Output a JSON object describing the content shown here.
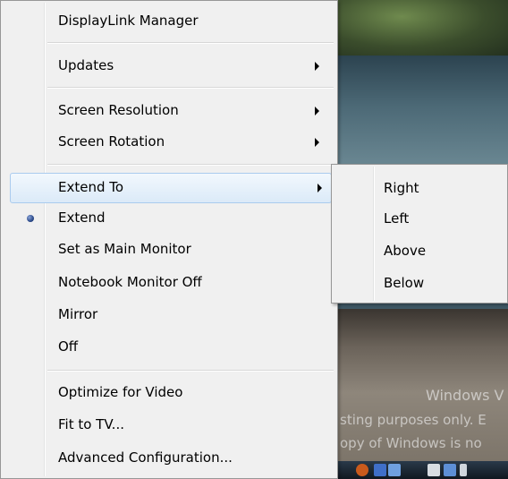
{
  "menu": {
    "items": [
      {
        "label": "DisplayLink Manager"
      },
      {
        "label": "Updates"
      },
      {
        "label": "Screen Resolution"
      },
      {
        "label": "Screen Rotation"
      },
      {
        "label": "Extend To"
      },
      {
        "label": "Extend"
      },
      {
        "label": "Set as Main Monitor"
      },
      {
        "label": "Notebook Monitor Off"
      },
      {
        "label": "Mirror"
      },
      {
        "label": "Off"
      },
      {
        "label": "Optimize for Video"
      },
      {
        "label": "Fit to TV..."
      },
      {
        "label": "Advanced Configuration..."
      }
    ]
  },
  "submenu": {
    "items": [
      {
        "label": "Right"
      },
      {
        "label": "Left"
      },
      {
        "label": "Above"
      },
      {
        "label": "Below"
      }
    ]
  },
  "desktop": {
    "watermark_line1": "Windows V",
    "watermark_line2": "sting purposes only. E",
    "watermark_line3": "opy of Windows is no"
  },
  "colors": {
    "menu_bg": "#f0f0f0",
    "highlight_border": "#aacbee",
    "highlight_fill": "#dbeaf8"
  }
}
